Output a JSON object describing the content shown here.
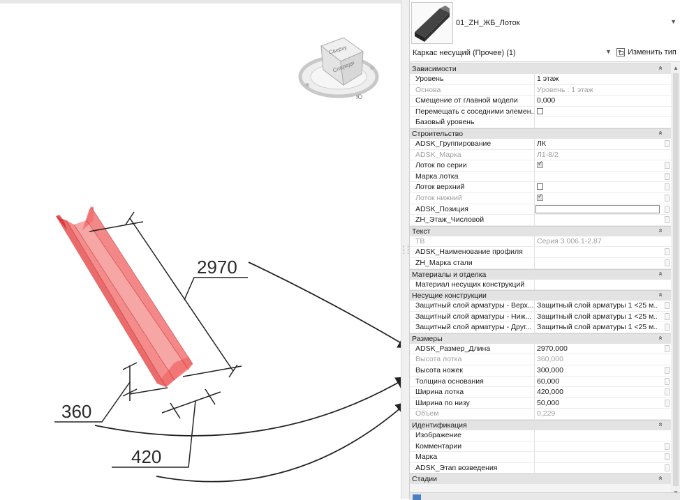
{
  "viewport": {
    "viewcube": {
      "top_label": "Сверху",
      "front_label": "Спереди",
      "compass_label": "Ю"
    },
    "dimensions": {
      "length": "2970",
      "height": "360",
      "width": "420"
    },
    "element_color": "#f05a5a"
  },
  "properties": {
    "type_name": "01_ZH_ЖБ_Лоток",
    "filter_label": "Каркас несущий (Прочее) (1)",
    "edit_type_label": "Изменить тип",
    "collapse_glyph": "»",
    "groups": [
      {
        "name": "Зависимости",
        "rows": [
          {
            "name": "Уровень",
            "value": "1 этаж"
          },
          {
            "name": "Основа",
            "value": "Уровень : 1 этаж",
            "gray": true
          },
          {
            "name": "Смещение от главной модели",
            "value": "0,000"
          },
          {
            "name": "Перемещать с соседними элемен...",
            "checkbox": false
          },
          {
            "name": "Базовый уровень",
            "value": ""
          }
        ]
      },
      {
        "name": "Строительство",
        "rows": [
          {
            "name": "ADSK_Группирование",
            "value": "ЛК",
            "assoc": true
          },
          {
            "name": "ADSK_Марка",
            "value": "Л1-8/2",
            "gray": true
          },
          {
            "name": "Лоток по серии",
            "checkbox": true,
            "assoc": true
          },
          {
            "name": "Марка лотка",
            "value": "",
            "assoc": true
          },
          {
            "name": "Лоток верхний",
            "checkbox": false,
            "assoc": true
          },
          {
            "name": "Лоток нижний",
            "checkbox": true,
            "gray": true,
            "assoc": true
          },
          {
            "name": "ADSK_Позиция",
            "value": "",
            "editing": true,
            "assoc": true
          },
          {
            "name": "ZH_Этаж_Числовой",
            "value": "",
            "assoc": true
          }
        ]
      },
      {
        "name": "Текст",
        "rows": [
          {
            "name": "ТВ",
            "value": "Серия 3.006.1-2.87",
            "gray": true
          },
          {
            "name": "ADSK_Наименование профиля",
            "value": "",
            "assoc": true
          },
          {
            "name": "ZH_Марка стали",
            "value": "",
            "assoc": true
          }
        ]
      },
      {
        "name": "Материалы и отделка",
        "rows": [
          {
            "name": "Материал несущих конструкций",
            "value": ""
          }
        ]
      },
      {
        "name": "Несущие конструкции",
        "rows": [
          {
            "name": "Защитный слой арматуры - Верх...",
            "value": "Защитный слой арматуры 1 <25 м...",
            "assoc": true
          },
          {
            "name": "Защитный слой арматуры - Ниж...",
            "value": "Защитный слой арматуры 1 <25 м...",
            "assoc": true
          },
          {
            "name": "Защитный слой арматуры - Друг...",
            "value": "Защитный слой арматуры 1 <25 м...",
            "assoc": true
          }
        ]
      },
      {
        "name": "Размеры",
        "rows": [
          {
            "name": "ADSK_Размер_Длина",
            "value": "2970,000",
            "assoc": true
          },
          {
            "name": "Высота лотка",
            "value": "360,000",
            "gray": true
          },
          {
            "name": "Высота ножек",
            "value": "300,000",
            "assoc": true
          },
          {
            "name": "Толщина основания",
            "value": "60,000",
            "assoc": true
          },
          {
            "name": "Ширина лотка",
            "value": "420,000",
            "assoc": true
          },
          {
            "name": "Ширина по низу",
            "value": "50,000",
            "assoc": true
          },
          {
            "name": "Объем",
            "value": "0,229",
            "gray": true
          }
        ]
      },
      {
        "name": "Идентификация",
        "rows": [
          {
            "name": "Изображение",
            "value": ""
          },
          {
            "name": "Комментарии",
            "value": "",
            "assoc": true
          },
          {
            "name": "Марка",
            "value": "",
            "assoc": true
          },
          {
            "name": "ADSK_Этап возведения",
            "value": "",
            "assoc": true
          }
        ]
      },
      {
        "name": "Стадии",
        "rows": []
      }
    ]
  }
}
